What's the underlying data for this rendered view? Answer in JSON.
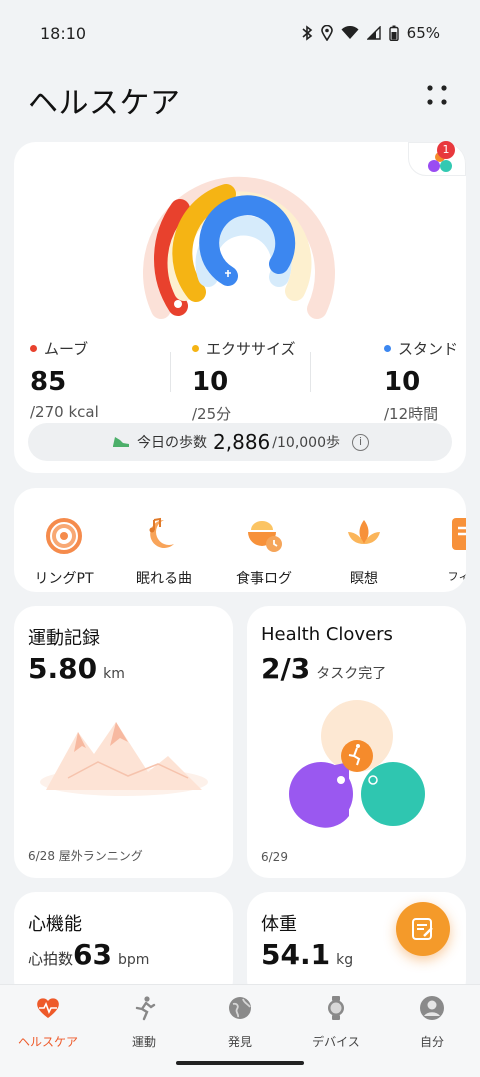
{
  "status": {
    "time": "18:10",
    "battery": "65%"
  },
  "header": {
    "title": "ヘルスケア",
    "clover_badge_count": "1"
  },
  "activity": {
    "move": {
      "label": "ムーブ",
      "value": "85",
      "goal": "/270 kcal",
      "color": "#e8412d",
      "progress": 0.31
    },
    "exercise": {
      "label": "エクササイズ",
      "value": "10",
      "goal": "/25分",
      "color": "#f5b414",
      "progress": 0.4
    },
    "stand": {
      "label": "スタンド",
      "value": "10",
      "goal": "/12時間",
      "color": "#3c87f0",
      "progress": 0.83
    },
    "steps": {
      "label": "今日の歩数",
      "value": "2,886",
      "goal": "/10,000歩",
      "info": "i"
    }
  },
  "quick": [
    {
      "label": "リングPT",
      "icon": "ring-pt-icon"
    },
    {
      "label": "眠れる曲",
      "icon": "sleep-music-icon"
    },
    {
      "label": "食事ログ",
      "icon": "meal-log-icon"
    },
    {
      "label": "瞑想",
      "icon": "meditation-icon"
    },
    {
      "label": "フィッ",
      "icon": "fitness-icon"
    }
  ],
  "exercise_record": {
    "title": "運動記録",
    "value": "5.80",
    "unit": "km",
    "footer": "6/28 屋外ランニング"
  },
  "clovers": {
    "title": "Health Clovers",
    "value": "2/3",
    "unit": "タスク完了",
    "footer": "6/29"
  },
  "heart": {
    "title": "心機能",
    "prefix": "心拍数",
    "value": "63",
    "unit": "bpm"
  },
  "weight": {
    "title": "体重",
    "value": "54.1",
    "unit": "kg"
  },
  "nav": [
    {
      "label": "ヘルスケア",
      "icon": "health-heart-icon",
      "active": true
    },
    {
      "label": "運動",
      "icon": "running-icon"
    },
    {
      "label": "発見",
      "icon": "discover-globe-icon"
    },
    {
      "label": "デバイス",
      "icon": "watch-icon"
    },
    {
      "label": "自分",
      "icon": "profile-icon"
    }
  ],
  "colors": {
    "accent": "#ee5a2a",
    "fab": "#f49a2a"
  }
}
